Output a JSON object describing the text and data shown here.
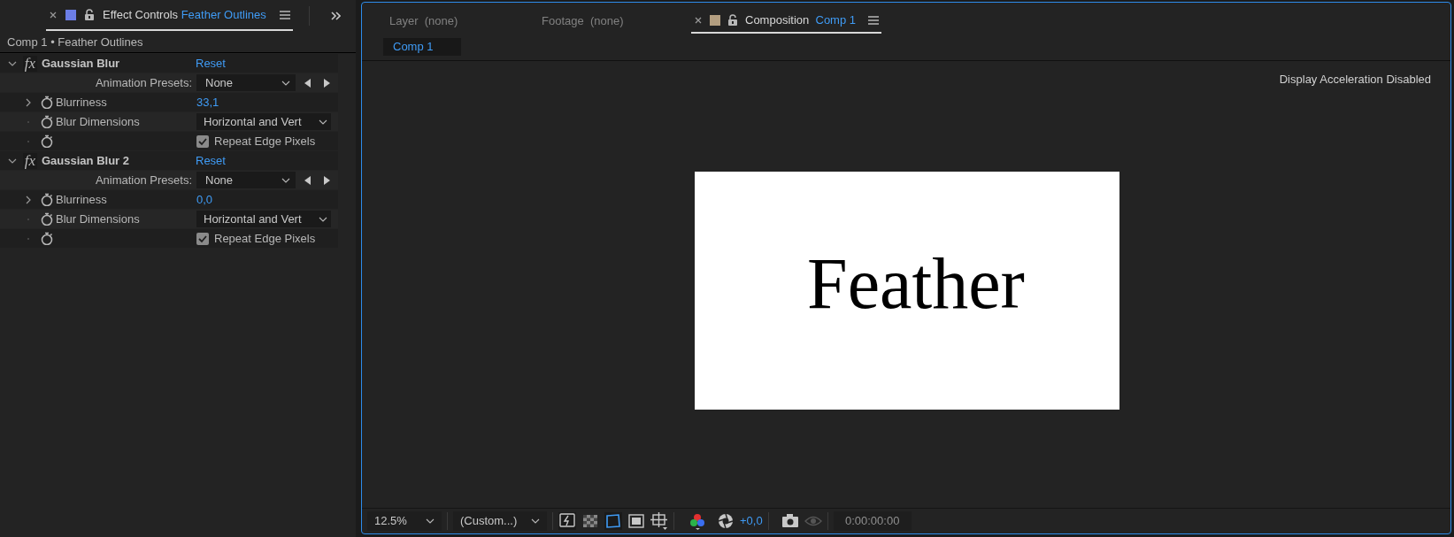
{
  "effect_panel": {
    "tab": {
      "label": "Effect Controls",
      "layer": "Feather Outlines",
      "selected": true
    },
    "breadcrumb": "Comp 1 • Feather Outlines",
    "effects": [
      {
        "badge": "fx",
        "name": "Gaussian Blur",
        "expanded": true,
        "reset": "Reset",
        "properties": [
          {
            "kind": "preset",
            "label": "Animation Presets:",
            "value": "None"
          },
          {
            "kind": "number",
            "label": "Blurriness",
            "value": "33,1",
            "expanded": false
          },
          {
            "kind": "dropdown",
            "label": "Blur Dimensions",
            "value": "Horizontal and Vert"
          },
          {
            "kind": "checkbox",
            "label": "Repeat Edge Pixels",
            "checked": true
          }
        ]
      },
      {
        "badge": "fx",
        "name": "Gaussian Blur 2",
        "expanded": true,
        "reset": "Reset",
        "properties": [
          {
            "kind": "preset",
            "label": "Animation Presets:",
            "value": "None"
          },
          {
            "kind": "number",
            "label": "Blurriness",
            "value": "0,0",
            "expanded": false
          },
          {
            "kind": "dropdown",
            "label": "Blur Dimensions",
            "value": "Horizontal and Vert"
          },
          {
            "kind": "checkbox",
            "label": "Repeat Edge Pixels",
            "checked": true
          }
        ]
      }
    ]
  },
  "viewer": {
    "tabs": [
      {
        "label": "Layer",
        "target": "(none)",
        "selected": false
      },
      {
        "label": "Footage",
        "target": "(none)",
        "selected": false
      },
      {
        "label": "Composition",
        "target": "Comp 1",
        "selected": true
      }
    ],
    "comp_tabs": [
      {
        "label": "Comp 1",
        "selected": true
      }
    ],
    "notice": "Display Acceleration Disabled",
    "canvas_text": "Feather",
    "toolbar": {
      "zoom": "12.5%",
      "resolution": "(Custom...)",
      "exposure": "+0,0",
      "timecode": "0:00:00:00"
    }
  }
}
